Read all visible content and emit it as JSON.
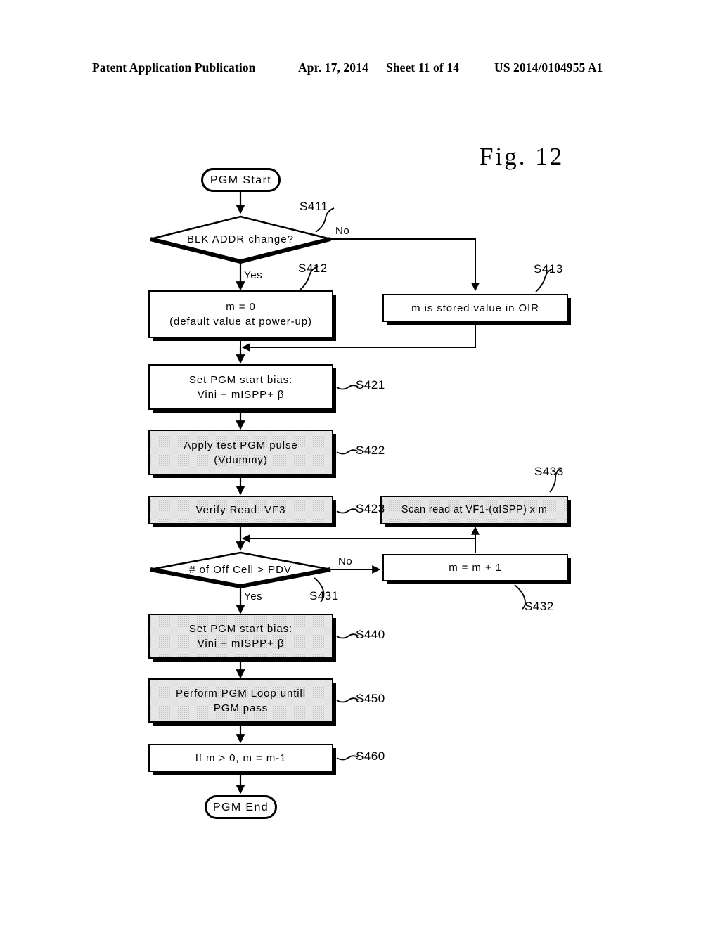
{
  "header": {
    "publication": "Patent Application Publication",
    "date": "Apr. 17, 2014",
    "sheet": "Sheet 11 of 14",
    "number": "US 2014/0104955 A1"
  },
  "figure": {
    "title": "Fig.  12"
  },
  "flowchart": {
    "nodes": {
      "start": {
        "label": "PGM Start",
        "type": "terminator"
      },
      "s411": {
        "label": "BLK ADDR change?",
        "type": "decision",
        "ref": "S411"
      },
      "s412": {
        "label": "m = 0\n(default value at power-up)",
        "type": "process",
        "ref": "S412",
        "shaded": false
      },
      "s413": {
        "label": "m is stored value in OIR",
        "type": "process",
        "ref": "S413",
        "shaded": false
      },
      "s421": {
        "label": "Set PGM start bias:\nVini + mISPP+ β",
        "type": "process",
        "ref": "S421",
        "shaded": false
      },
      "s422": {
        "label": "Apply test PGM pulse\n(Vdummy)",
        "type": "process",
        "ref": "S422",
        "shaded": true
      },
      "s423": {
        "label": "Verify Read: VF3",
        "type": "process",
        "ref": "S423",
        "shaded": true
      },
      "s433": {
        "label": "Scan read at VF1-(αISPP) x m",
        "type": "process",
        "ref": "S433",
        "shaded": true
      },
      "s431": {
        "label": "# of Off Cell > PDV",
        "type": "decision",
        "ref": "S431"
      },
      "s432": {
        "label": "m = m + 1",
        "type": "process",
        "ref": "S432",
        "shaded": false
      },
      "s440": {
        "label": "Set PGM start bias:\nVini + mISPP+ β",
        "type": "process",
        "ref": "S440",
        "shaded": true
      },
      "s450": {
        "label": "Perform PGM Loop untill\nPGM pass",
        "type": "process",
        "ref": "S450",
        "shaded": true
      },
      "s460": {
        "label": "If m > 0, m = m-1",
        "type": "process",
        "ref": "S460",
        "shaded": false
      },
      "end": {
        "label": "PGM End",
        "type": "terminator"
      }
    },
    "branches": {
      "s411_no": "No",
      "s411_yes": "Yes",
      "s431_no": "No",
      "s431_yes": "Yes"
    }
  }
}
